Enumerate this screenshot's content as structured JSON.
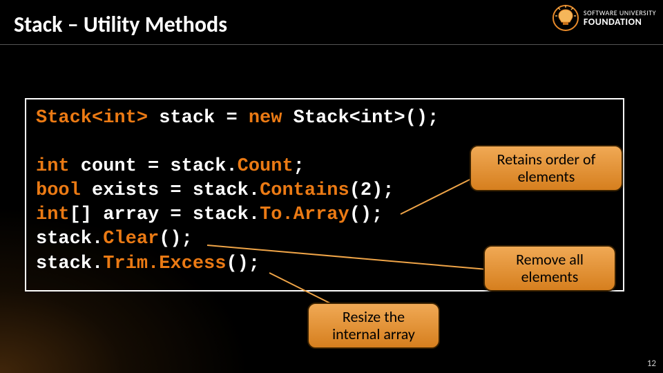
{
  "title": "Stack – Utility Methods",
  "logo": {
    "line1": "SOFTWARE UNIVERSITY",
    "line2": "FOUNDATION"
  },
  "code": {
    "l1a": "Stack<int>",
    "l1b": " stack = ",
    "l1c": "new",
    "l1d": " Stack<int>();",
    "blank": "",
    "l2a": "int",
    "l2b": " count = stack.",
    "l2c": "Count",
    "l2d": ";",
    "l3a": "bool",
    "l3b": " exists = stack.",
    "l3c": "Contains",
    "l3d": "(2);",
    "l4a": "int",
    "l4b": "[] array = stack.",
    "l4c": "To.Array",
    "l4d": "();",
    "l5a": "stack.",
    "l5b": "Clear",
    "l5c": "();",
    "l6a": "stack.",
    "l6b": "Trim.Excess",
    "l6c": "();"
  },
  "callouts": {
    "retain": "Retains order of\nelements",
    "remove": "Remove all\nelements",
    "resize": "Resize the\ninternal array"
  },
  "pageNumber": "12"
}
